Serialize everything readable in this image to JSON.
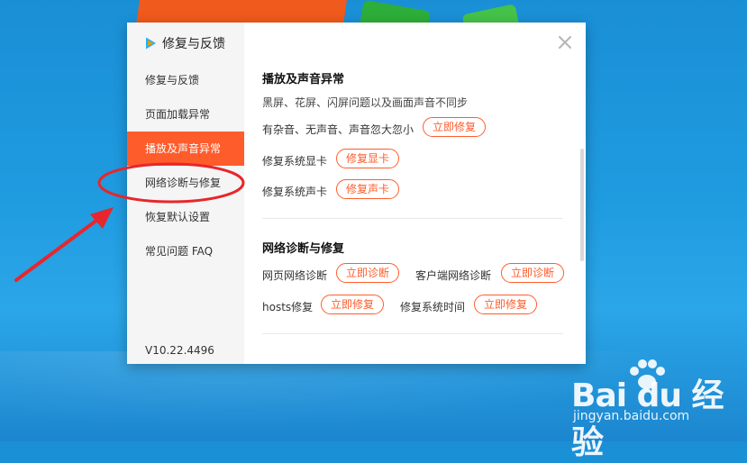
{
  "dialog": {
    "title": "修复与反馈",
    "close_icon": "close-icon",
    "version": "V10.22.4496"
  },
  "sidebar": {
    "items": [
      {
        "label": "修复与反馈",
        "active": false
      },
      {
        "label": "页面加载异常",
        "active": false
      },
      {
        "label": "播放及声音异常",
        "active": true
      },
      {
        "label": "网络诊断与修复",
        "active": false
      },
      {
        "label": "恢复默认设置",
        "active": false
      },
      {
        "label": "常见问题 FAQ",
        "active": false
      }
    ]
  },
  "playback": {
    "title": "播放及声音异常",
    "desc": "黑屏、花屏、闪屏问题以及画面声音不同步",
    "noise_label": "有杂音、无声音、声音忽大忽小",
    "noise_button": "立即修复",
    "gpu_label": "修复系统显卡",
    "gpu_button": "修复显卡",
    "sound_label": "修复系统声卡",
    "sound_button": "修复声卡"
  },
  "network": {
    "title": "网络诊断与修复",
    "web_label": "网页网络诊断",
    "web_button": "立即诊断",
    "client_label": "客户端网络诊断",
    "client_button": "立即诊断",
    "hosts_label": "hosts修复",
    "hosts_button": "立即修复",
    "time_label": "修复系统时间",
    "time_button": "立即修复"
  },
  "watermark": {
    "brand": "Bai du 经验",
    "url": "jingyan.baidu.com"
  },
  "colors": {
    "accent": "#ff5c2c",
    "annotation": "#e8262b",
    "desktop": "#1f9be0"
  }
}
